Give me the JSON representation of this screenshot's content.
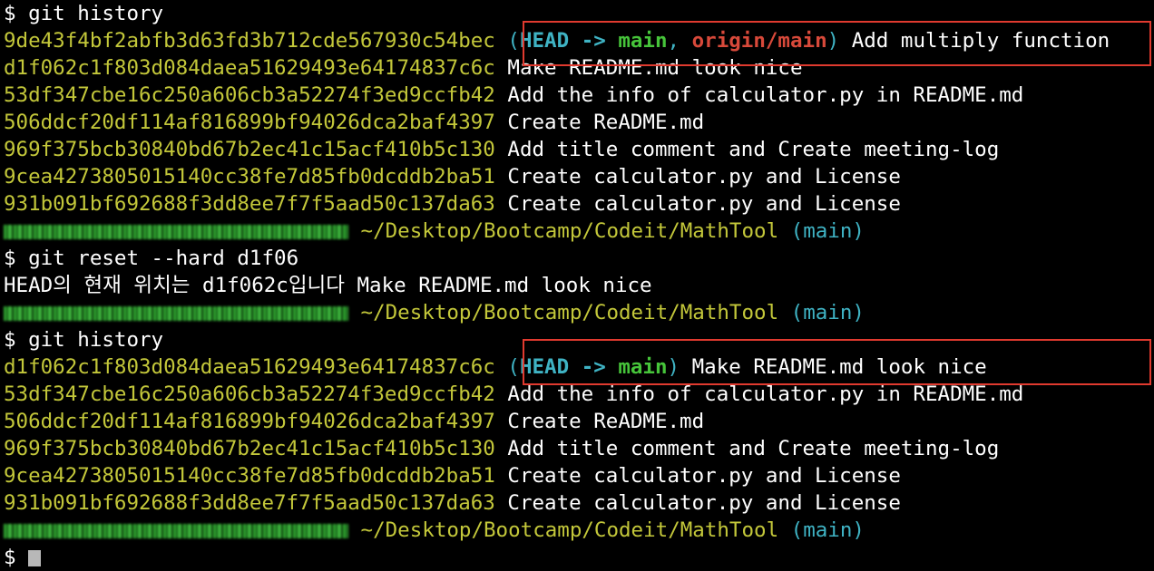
{
  "terminal": {
    "prompt_symbol": "$",
    "commands": [
      "git history",
      "git reset --hard d1f06",
      "git history"
    ],
    "first_history": [
      {
        "hash": "9de43f4bf2abfb3d63fd3b712cde567930c54bec",
        "refs_head": "HEAD",
        "refs_arrow": "->",
        "refs_main": "main",
        "refs_origin": "origin/main",
        "message": "Add multiply function"
      },
      {
        "hash": "d1f062c1f803d084daea51629493e64174837c6c",
        "message": "Make README.md look nice"
      },
      {
        "hash": "53df347cbe16c250a606cb3a52274f3ed9ccfb42",
        "message": "Add the info of calculator.py in README.md"
      },
      {
        "hash": "506ddcf20df114af816899bf94026dca2baf4397",
        "message": "Create ReADME.md"
      },
      {
        "hash": "969f375bcb30840bd67b2ec41c15acf410b5c130",
        "message": "Add title comment and Create meeting-log"
      },
      {
        "hash": "9cea4273805015140cc38fe7d85fb0dcddb2ba51",
        "message": "Create calculator.py and License"
      },
      {
        "hash": "931b091bf692688f3dd8ee7f7f5aad50c137da63",
        "message": "Create calculator.py and License"
      }
    ],
    "prompt_path": "~/Desktop/Bootcamp/Codeit/MathTool",
    "prompt_branch": "(main)",
    "reset_output": "HEAD의 현재 위치는 d1f062c입니다 Make README.md look nice",
    "second_history": [
      {
        "hash": "d1f062c1f803d084daea51629493e64174837c6c",
        "refs_head": "HEAD",
        "refs_arrow": "->",
        "refs_main": "main",
        "message": "Make README.md look nice"
      },
      {
        "hash": "53df347cbe16c250a606cb3a52274f3ed9ccfb42",
        "message": "Add the info of calculator.py in README.md"
      },
      {
        "hash": "506ddcf20df114af816899bf94026dca2baf4397",
        "message": "Create ReADME.md"
      },
      {
        "hash": "969f375bcb30840bd67b2ec41c15acf410b5c130",
        "message": "Add title comment and Create meeting-log"
      },
      {
        "hash": "9cea4273805015140cc38fe7d85fb0dcddb2ba51",
        "message": "Create calculator.py and License"
      },
      {
        "hash": "931b091bf692688f3dd8ee7f7f5aad50c137da63",
        "message": "Create calculator.py and License"
      }
    ]
  },
  "colors": {
    "background": "#000000",
    "hash": "#c3c73a",
    "head": "#3fb3c4",
    "main": "#46c43a",
    "origin": "#d8493a",
    "highlight_box": "#e03a2f"
  }
}
